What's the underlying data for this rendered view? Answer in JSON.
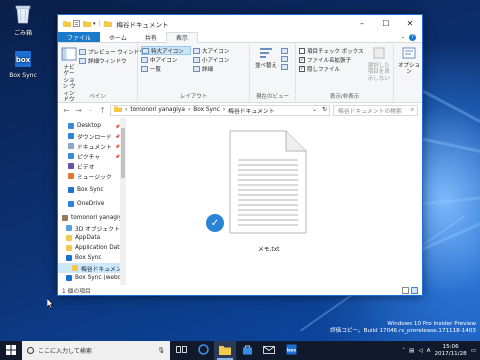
{
  "desktop": {
    "icons": [
      {
        "label": "ごみ箱",
        "icon": "recycle-bin-icon"
      },
      {
        "label": "Box Sync",
        "icon": "box-sync-icon"
      }
    ]
  },
  "window": {
    "title": "梅谷ドキュメント",
    "tabs": [
      "ファイル",
      "ホーム",
      "共有",
      "表示"
    ],
    "active_tab": "表示",
    "ribbon": {
      "pane": {
        "navigation_pane": "ナビゲーション ウィンドウ",
        "preview_pane": "プレビュー ウィンドウ",
        "details_pane": "詳細ウィンドウ",
        "label": "ペイン"
      },
      "layout": {
        "items": [
          "特大アイコン",
          "大アイコン",
          "中アイコン",
          "小アイコン",
          "一覧",
          "詳細"
        ],
        "selected": "特大アイコン",
        "label": "レイアウト"
      },
      "current_view": {
        "sort": "並べ替え",
        "label": "現在のビュー"
      },
      "show_hide": {
        "item_checkboxes": "項目チェック ボックス",
        "file_extensions": "ファイル名拡張子",
        "hidden_items": "隠しファイル",
        "hide_selected": "選択した項目を表示しない",
        "label": "表示/非表示"
      },
      "options": "オプション"
    },
    "address": {
      "path": [
        "tomonori yanagiya",
        "Box Sync",
        "梅谷ドキュメント"
      ],
      "search_placeholder": "梅谷ドキュメントの検索"
    },
    "nav_pane": [
      {
        "label": "Desktop",
        "icon": "desktop-icon",
        "pinned": true
      },
      {
        "label": "ダウンロード",
        "icon": "download-icon",
        "pinned": true
      },
      {
        "label": "ドキュメント",
        "icon": "documents-icon",
        "pinned": true
      },
      {
        "label": "ピクチャ",
        "icon": "pictures-icon",
        "pinned": true
      },
      {
        "label": "ビデオ",
        "icon": "video-icon",
        "pinned": false
      },
      {
        "label": "ミュージック",
        "icon": "music-icon",
        "pinned": false
      },
      {
        "label": "",
        "icon": "",
        "pinned": false
      },
      {
        "label": "Box Sync",
        "icon": "box-sync-icon",
        "pinned": false
      },
      {
        "label": "",
        "icon": "",
        "pinned": false
      },
      {
        "label": "OneDrive",
        "icon": "onedrive-icon",
        "pinned": false
      },
      {
        "label": "",
        "icon": "",
        "pinned": false
      },
      {
        "label": "tomonori yanagiy",
        "icon": "user-icon",
        "pinned": false
      },
      {
        "label": "3D オブジェクト",
        "icon": "3d-objects-icon",
        "pinned": false
      },
      {
        "label": "AppData",
        "icon": "folder-icon",
        "pinned": false
      },
      {
        "label": "Application Data",
        "icon": "folder-shortcut-icon",
        "pinned": false
      },
      {
        "label": "Box Sync",
        "icon": "box-sync-icon",
        "pinned": false
      },
      {
        "label": "梅谷ドキュメント",
        "icon": "folder-icon",
        "pinned": false,
        "selected": true
      },
      {
        "label": "Box Sync (webd",
        "icon": "box-sync-icon",
        "pinned": false
      }
    ],
    "files": [
      {
        "name": "メモ.txt",
        "icon": "text-file-icon",
        "checked": true
      }
    ],
    "status": "1 個の項目"
  },
  "watermark": {
    "line1": "Windows 10 Pro Insider Preview",
    "line2": "評価コピー。Build 17046.rs_prerelease.171118-1403"
  },
  "taskbar": {
    "search_placeholder": "ここに入力して検索",
    "time": "15:06",
    "date": "2017/11/28",
    "apps": [
      "task-view-icon",
      "edge-icon",
      "file-explorer-icon",
      "store-icon",
      "mail-icon",
      "box-icon"
    ]
  },
  "colors": {
    "accent": "#1979ca",
    "selection": "#cce8ff",
    "taskbar": "#101a2c"
  }
}
